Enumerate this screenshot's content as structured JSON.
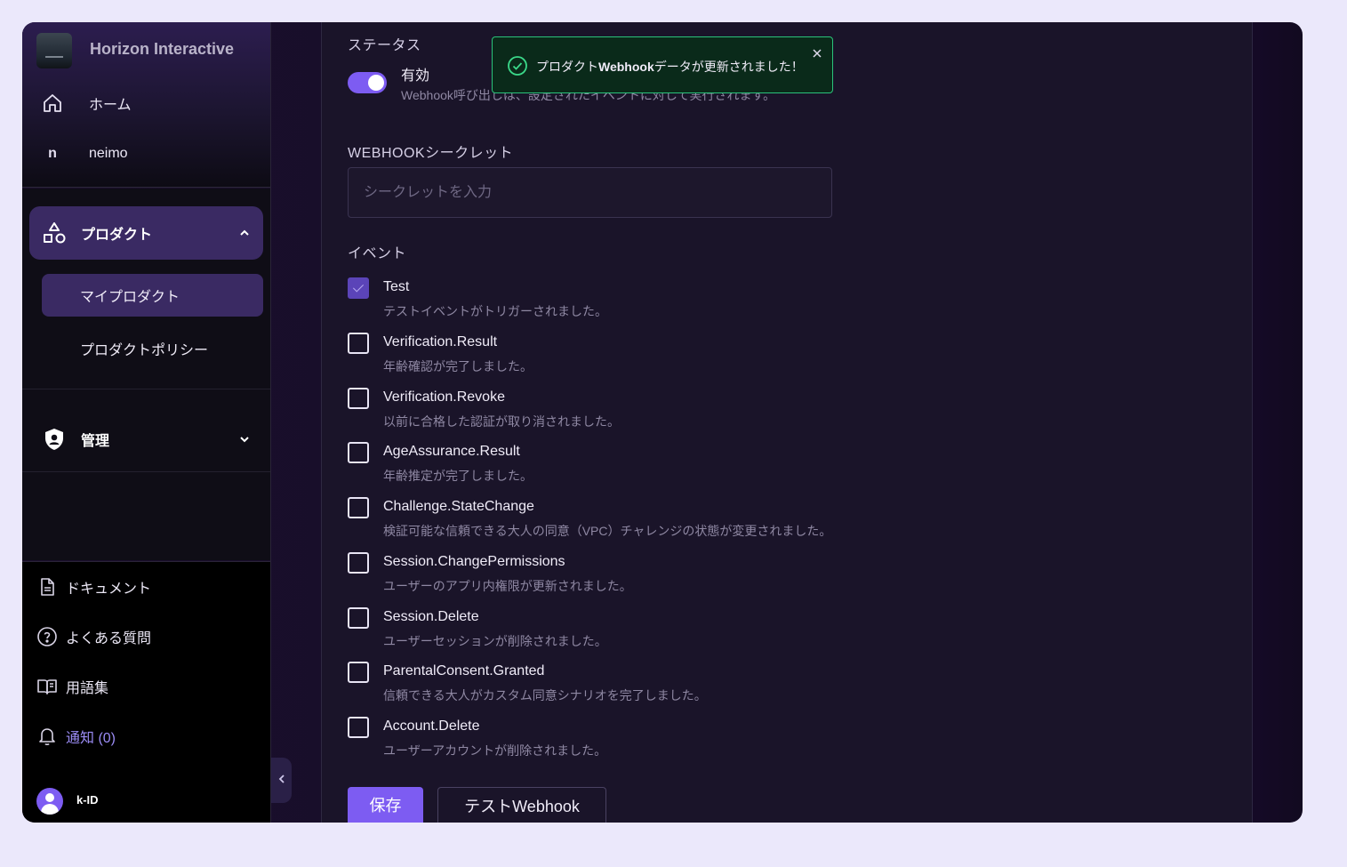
{
  "sidebar": {
    "org_name": "Horizon Interactive",
    "nav": [
      {
        "label": "ホーム",
        "icon": "home-icon"
      },
      {
        "label": "neimo",
        "icon_letter": "n"
      }
    ],
    "groups": [
      {
        "label": "プロダクト",
        "icon": "shapes-icon",
        "expanded": true,
        "items": [
          {
            "label": "マイプロダクト",
            "active": true
          },
          {
            "label": "プロダクトポリシー",
            "active": false
          }
        ]
      },
      {
        "label": "管理",
        "icon": "shield-user-icon",
        "expanded": false
      }
    ],
    "bottom": [
      {
        "label": "ドキュメント",
        "icon": "document-icon"
      },
      {
        "label": "よくある質問",
        "icon": "question-circle-icon"
      },
      {
        "label": "用語集",
        "icon": "book-icon"
      },
      {
        "label": "通知 (0)",
        "icon": "bell-icon"
      }
    ],
    "user": {
      "name": "k-ID"
    }
  },
  "form": {
    "status_label": "ステータス",
    "toggle": {
      "label": "有効",
      "on": true,
      "description": "Webhook呼び出しは、設定されたイベントに対して実行されます。"
    },
    "secret": {
      "label": "WEBHOOKシークレット",
      "placeholder": "シークレットを入力",
      "value": ""
    },
    "events_label": "イベント",
    "events": [
      {
        "name": "Test",
        "description": "テストイベントがトリガーされました。",
        "checked": true
      },
      {
        "name": "Verification.Result",
        "description": "年齢確認が完了しました。",
        "checked": false
      },
      {
        "name": "Verification.Revoke",
        "description": "以前に合格した認証が取り消されました。",
        "checked": false
      },
      {
        "name": "AgeAssurance.Result",
        "description": "年齢推定が完了しました。",
        "checked": false
      },
      {
        "name": "Challenge.StateChange",
        "description": "検証可能な信頼できる大人の同意（VPC）チャレンジの状態が変更されました。",
        "checked": false
      },
      {
        "name": "Session.ChangePermissions",
        "description": "ユーザーのアプリ内権限が更新されました。",
        "checked": false
      },
      {
        "name": "Session.Delete",
        "description": "ユーザーセッションが削除されました。",
        "checked": false
      },
      {
        "name": "ParentalConsent.Granted",
        "description": "信頼できる大人がカスタム同意シナリオを完了しました。",
        "checked": false
      },
      {
        "name": "Account.Delete",
        "description": "ユーザーアカウントが削除されました。",
        "checked": false
      }
    ],
    "save_label": "保存",
    "test_label": "テストWebhook"
  },
  "toast": {
    "prefix": "プロダクト",
    "bold": "Webhook",
    "suffix": "データが更新されました！"
  },
  "colors": {
    "accent": "#7d5cf2",
    "success": "#2bc27a",
    "panel_bg": "#1a1429"
  }
}
